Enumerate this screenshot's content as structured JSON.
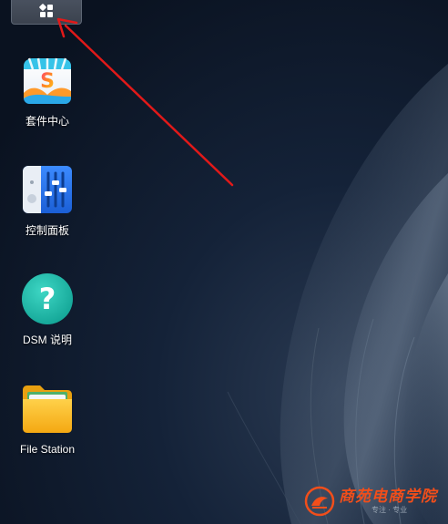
{
  "desktop": {
    "shortcuts": [
      {
        "label": "套件中心",
        "icon": "package-center-icon"
      },
      {
        "label": "控制面板",
        "icon": "control-panel-icon"
      },
      {
        "label": "DSM 说明",
        "icon": "dsm-help-icon"
      },
      {
        "label": "File Station",
        "icon": "file-station-icon"
      }
    ]
  },
  "taskbar": {
    "main_menu_icon": "main-menu-grid-icon"
  },
  "annotation": {
    "type": "arrow",
    "color": "#e11919",
    "points_to": "main-menu-button"
  },
  "watermark": {
    "brand": "商苑电商学院",
    "tagline": "专注 · 专业"
  },
  "colors": {
    "wallpaper_dark": "#0b1424",
    "arrow": "#e11919",
    "watermark": "#f24e1a",
    "help_icon": "#1fb8a8",
    "control_panel_blue": "#2a6fe0",
    "folder_yellow": "#f6b81c"
  }
}
